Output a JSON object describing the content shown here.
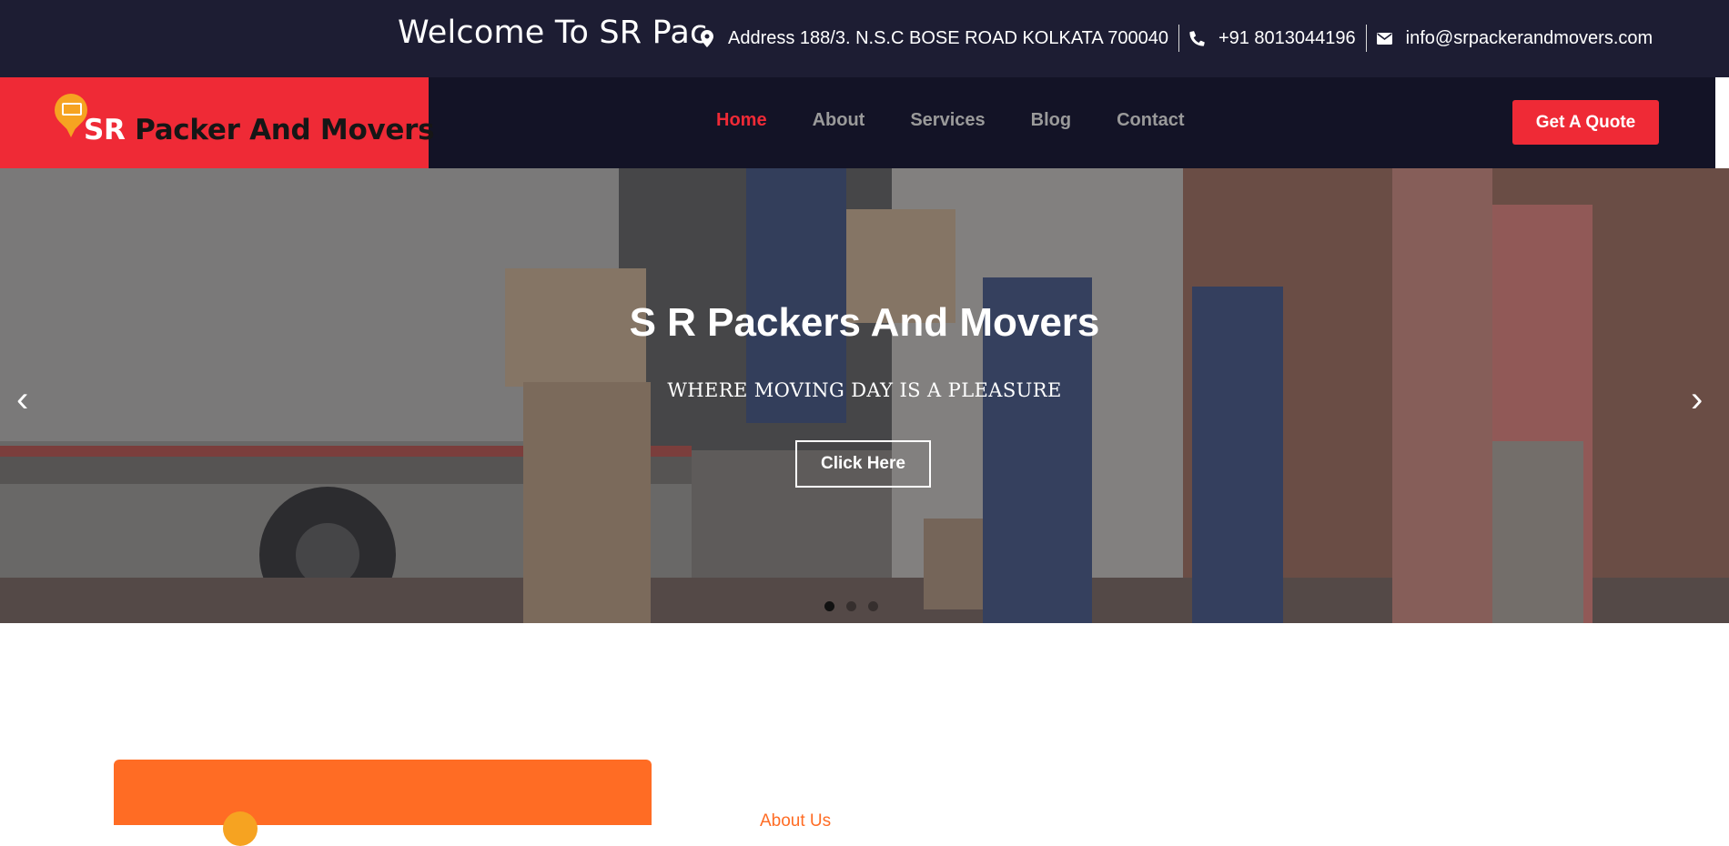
{
  "topbar": {
    "welcome": "Welcome To SR Pac",
    "address": "Address 188/3. N.S.C BOSE ROAD KOLKATA 700040",
    "phone": "+91 8013044196",
    "email": "info@srpackerandmovers.com",
    "icons": [
      "map-pin-icon",
      "phone-icon",
      "envelope-icon"
    ]
  },
  "header": {
    "logo": {
      "part1": "SR",
      "part2": " Packer And Movers"
    },
    "nav": [
      {
        "label": "Home",
        "active": true
      },
      {
        "label": "About",
        "active": false
      },
      {
        "label": "Services",
        "active": false
      },
      {
        "label": "Blog",
        "active": false
      },
      {
        "label": "Contact",
        "active": false
      }
    ],
    "cta": "Get A Quote"
  },
  "hero": {
    "title": "S R Packers And Movers",
    "subtitle": "WHERE MOVING DAY IS A PLEASURE",
    "button": "Click Here",
    "slides": 3,
    "active_slide": 1
  },
  "about": {
    "label": "About Us"
  },
  "colors": {
    "topbar_bg": "#1d1d33",
    "header_bg": "#131326",
    "accent_red": "#ef2a36",
    "accent_orange": "#ff6c24",
    "logo_pin": "#f6a321"
  }
}
